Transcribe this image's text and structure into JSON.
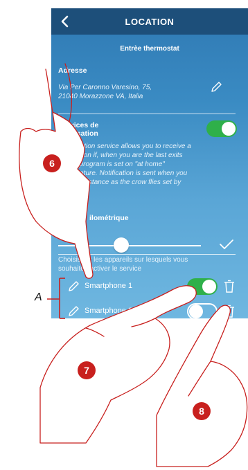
{
  "header": {
    "title": "LOCATION"
  },
  "subtitle": "Entrèe thermostat",
  "address": {
    "label": "Adresse",
    "line1": "Via Per Caronno Varesino, 75,",
    "line2": "21040 Morazzone VA, Italia"
  },
  "services": {
    "label_line1": "Services de",
    "label_line2": "localisation",
    "enabled": true,
    "desc_lines": [
      "Geolocation service allows you to receive a",
      "notification if, when you are the last exits",
      "home, program is set on \"at home\"",
      "temperature. Notification is sent when you",
      "reach a distance as the crow flies set by"
    ]
  },
  "distance": {
    "label": "ilométrique"
  },
  "devices_intro": {
    "line1": "Choisissez les appareils sur lesquels vous",
    "line2": "souhaitez activer le service"
  },
  "devices": [
    {
      "name": "Smartphone 1",
      "enabled": true
    },
    {
      "name": "Smartphone 2",
      "enabled": false
    }
  ],
  "annotations": {
    "bracket_label": "A",
    "step6": "6",
    "step7": "7",
    "step8": "8"
  },
  "colors": {
    "header": "#1d4f7a",
    "toggle_on": "#2fb04a",
    "badge": "#c8201e"
  },
  "icons": [
    "back-chevron-icon",
    "pencil-icon",
    "check-icon",
    "trash-icon"
  ]
}
